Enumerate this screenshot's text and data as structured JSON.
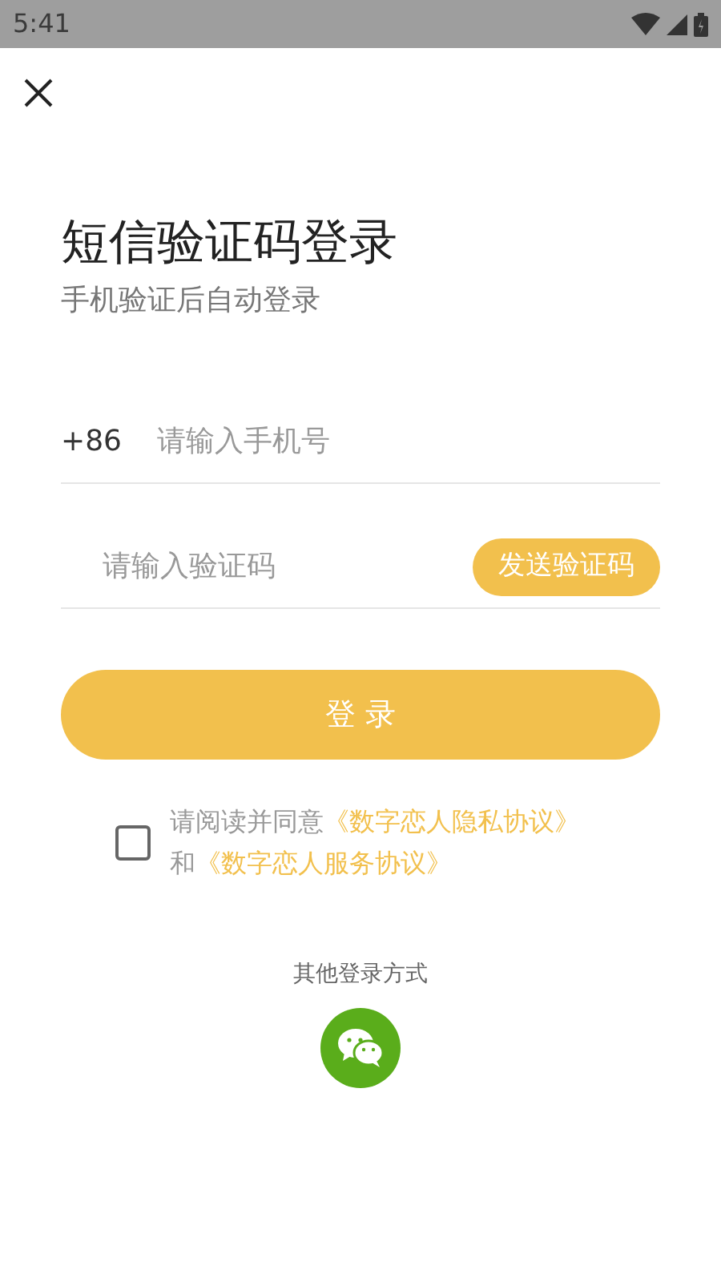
{
  "status_bar": {
    "time": "5:41"
  },
  "title": "短信验证码登录",
  "subtitle": "手机验证后自动登录",
  "phone": {
    "prefix": "+86",
    "placeholder": "请输入手机号"
  },
  "code": {
    "placeholder": "请输入验证码",
    "send_button": "发送验证码"
  },
  "login_button": "登 录",
  "agreement": {
    "checked": false,
    "parts": [
      {
        "kind": "text",
        "text": "请阅读并同意"
      },
      {
        "kind": "link",
        "text": "《数字恋人隐私协议》"
      },
      {
        "kind": "text",
        "text": "和"
      },
      {
        "kind": "link",
        "text": "《数字恋人服务协议》"
      }
    ]
  },
  "other_login": {
    "label": "其他登录方式"
  }
}
